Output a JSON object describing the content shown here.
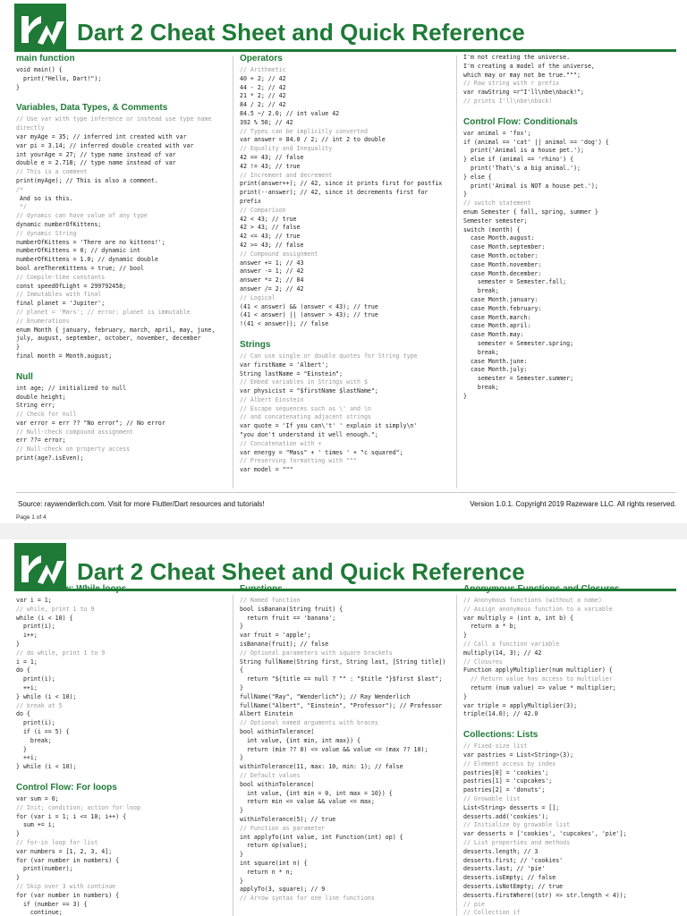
{
  "doc_title": "Dart 2 Cheat Sheet and Quick Reference",
  "brand_color": "#1e7a36",
  "comment_color": "#9a9a9a",
  "page1": {
    "col1": [
      {
        "title": "main function",
        "lines": [
          "void main() {",
          "  print(\"Hello, Dart!\");",
          "}"
        ]
      },
      {
        "title": "Variables, Data Types, & Comments",
        "lines": [
          "// Use var with type inference or instead use type name directly",
          "var myAge = 35; // inferred int created with var",
          "var pi = 3.14; // inferred double created with var",
          "int yourAge = 27; // type name instead of var",
          "double e = 2.718; // type name instead of var",
          "// This is a comment",
          "print(myAge); // This is also a comment.",
          "/*",
          " And so is this.",
          " */",
          "// dynamic can have value of any type",
          "dynamic numberOfKittens;",
          "// dynamic String",
          "numberOfKittens = 'There are no kittens!';",
          "numberOfKittens = 0; // dynamic int",
          "numberOfKittens = 1.0; // dynamic double",
          "bool areThereKittens = true; // bool",
          "// Compile-time constants",
          "const speedOfLight = 299792458;",
          "// Immutables with final",
          "final planet = 'Jupiter';",
          "// planet = 'Mars'; // error: planet is immutable",
          "// Enumerations",
          "enum Month { january, february, march, april, may, june, july, august, september, october, november, december",
          "}",
          "final month = Month.august;"
        ]
      },
      {
        "title": "Null",
        "lines": [
          "int age; // initialized to null",
          "double height;",
          "String err;",
          "// Check for null",
          "var error = err ?? \"No error\"; // No error",
          "// Null-check compound assignment",
          "err ??= error;",
          "// Null-check on property access",
          "print(age?.isEven);"
        ]
      }
    ],
    "col2": [
      {
        "title": "Operators",
        "lines": [
          "// Arithmetic",
          "40 + 2; // 42",
          "44 - 2; // 42",
          "21 * 2; // 42",
          "84 / 2; // 42",
          "84.5 ~/ 2.0; // int value 42",
          "392 % 50; // 42",
          "// Types can be implicitly converted",
          "var answer = 84.0 / 2; // int 2 to double",
          "// Equality and Inequality",
          "42 == 43; // false",
          "42 != 43; // true",
          "// Increment and decrement",
          "print(answer++); // 42, since it prints first for postfix",
          "print(--answer); // 42, since it decrements first for prefix",
          "// Comparison",
          "42 < 43; // true",
          "42 > 43; // false",
          "42 <= 43; // true",
          "42 >= 43; // false",
          "// Compound assignment",
          "answer += 1; // 43",
          "answer -= 1; // 42",
          "answer *= 2; // 84",
          "answer /= 2; // 42",
          "// Logical",
          "(41 < answer) && (answer < 43); // true",
          "(41 < answer) || (answer > 43); // true",
          "!(41 < answer)); // false"
        ]
      },
      {
        "title": "Strings",
        "lines": [
          "// Can use single or double quotes for String type",
          "var firstName = 'Albert';",
          "String lastName = \"Einstein\";",
          "// Embed variables in Strings with $",
          "var physicist = \"$firstName $lastName\";",
          "// Albert Einstein",
          "// Escape sequences such as \\' and \\n",
          "// and concatenating adjacent strings",
          "var quote = 'If you can\\'t' ' explain it simply\\n'",
          "\"you don't understand it well enough.\";",
          "// Concatenation with +",
          "var energy = \"Mass\" + ' times ' + \"c squared\";",
          "// Preserving formatting with \"\"\"",
          "var model = \"\"\""
        ]
      }
    ],
    "col3": [
      {
        "title": "",
        "lines": [
          "I'm not creating the universe.",
          "I'm creating a model of the universe,",
          "which may or may not be true.\"\"\";",
          "// Raw string with r prefix",
          "var rawString =r\"I'll\\nbe\\nback!\";",
          "// prints I'll\\nbe\\nback!"
        ]
      },
      {
        "title": "Control Flow: Conditionals",
        "lines": [
          "var animal = 'fox';",
          "if (animal == 'cat' || animal == 'dog') {",
          "  print('Animal is a house pet.');",
          "} else if (animal == 'rhino') {",
          "  print('That\\'s a big animal.');",
          "} else {",
          "  print('Animal is NOT a house pet.');",
          "}",
          "// switch statement",
          "enum Semester { fall, spring, summer }",
          "Semester semester;",
          "switch (month) {",
          "  case Month.august:",
          "  case Month.september:",
          "  case Month.october:",
          "  case Month.november:",
          "  case Month.december:",
          "    semester = Semester.fall;",
          "    break;",
          "  case Month.january:",
          "  case Month.february:",
          "  case Month.march:",
          "  case Month.april:",
          "  case Month.may:",
          "    semester = Semester.spring;",
          "    break;",
          "  case Month.june:",
          "  case Month.july:",
          "    semester = Semester.summer;",
          "    break;",
          "}"
        ]
      }
    ],
    "footer": {
      "source": "Source: raywenderlich.com.  Visit for more Flutter/Dart resources and tutorials!",
      "version": "Version 1.0.1. Copyright 2019 Razeware LLC. All rights reserved.",
      "page": "Page 1 of 4"
    }
  },
  "page2": {
    "col1": [
      {
        "title": "Control Flow: While loops",
        "lines": [
          "var i = 1;",
          "// while, print 1 to 9",
          "while (i < 10) {",
          "  print(i);",
          "  i++;",
          "}",
          "// do while, print 1 to 9",
          "i = 1;",
          "do {",
          "  print(i);",
          "  ++i;",
          "} while (i < 10);",
          "// break at 5",
          "do {",
          "  print(i);",
          "  if (i == 5) {",
          "    break;",
          "  }",
          "  ++i;",
          "} while (i < 10);"
        ]
      },
      {
        "title": "Control Flow: For loops",
        "lines": [
          "var sum = 0;",
          "// Init; condition; action for loop",
          "for (var i = 1; i <= 10; i++) {",
          "  sum += i;",
          "}",
          "// for-in loop for list",
          "var numbers = [1, 2, 3, 4];",
          "for (var number in numbers) {",
          "  print(number);",
          "}",
          "// Skip over 3 with continue",
          "for (var number in numbers) {",
          "  if (number == 3) {",
          "    continue;"
        ]
      }
    ],
    "col2": [
      {
        "title": "Functions",
        "lines": [
          "// Named function",
          "bool isBanana(String fruit) {",
          "  return fruit == 'banana';",
          "}",
          "var fruit = 'apple';",
          "isBanana(fruit); // false",
          "// Optional parameters with square brackets",
          "String fullName(String first, String last, [String title]) {",
          "  return \"${title == null ? \"\" : \"$title \"}$first $last\";",
          "}",
          "fullName(\"Ray\", \"Wenderlich\"); // Ray Wenderlich",
          "fullName(\"Albert\", \"Einstein\", \"Professor\"); // Professor Albert Einstein",
          "// Optional named arguments with braces",
          "bool withinTolerance(",
          "  int value, {int min, int max}) {",
          "  return (min ?? 0) <= value && value <= (max ?? 10);",
          "}",
          "withinTolerance(11, max: 10, min: 1); // false",
          "// Default values",
          "bool withinTolerance(",
          "  int value, {int min = 0, int max = 10}) {",
          "  return min <= value && value <= max;",
          "}",
          "withinTolerance(5); // true",
          "// Function as parameter",
          "int applyTo(int value, int Function(int) op) {",
          "  return op(value);",
          "}",
          "int square(int n) {",
          "  return n * n;",
          "}",
          "applyTo(3, square); // 9",
          "// Arrow syntax for one line functions"
        ]
      }
    ],
    "col3": [
      {
        "title": "Anonymous Functions and Closures",
        "lines": [
          "// Anonymous functions (without a name)",
          "// Assign anonymous function to a variable",
          "var multiply = (int a, int b) {",
          "  return a * b;",
          "}",
          "// Call a function variable",
          "multiply(14, 3); // 42",
          "// Closures",
          "Function applyMultiplier(num multiplier) {",
          "  // Return value has access to multiplier",
          "  return (num value) => value * multiplier;",
          "}",
          "var triple = applyMultiplier(3);",
          "triple(14.0); // 42.0"
        ]
      },
      {
        "title": "Collections: Lists",
        "lines": [
          "// Fixed-size list",
          "var pastries = List<String>(3);",
          "// Element access by index",
          "pastries[0] = 'cookies';",
          "pastries[1] = 'cupcakes';",
          "pastries[2] = 'donuts';",
          "// Growable list",
          "List<String> desserts = [];",
          "desserts.add('cookies');",
          "// Initialize by growable list",
          "var desserts = ['cookies', 'cupcakes', 'pie'];",
          "// List properties and methods",
          "desserts.length; // 3",
          "desserts.first; // 'cookies'",
          "desserts.last; // 'pie'",
          "desserts.isEmpty; // false",
          "desserts.isNotEmpty; // true",
          "desserts.firstWhere((str) => str.length < 4));",
          "// pie",
          "// Collection if"
        ]
      }
    ]
  }
}
